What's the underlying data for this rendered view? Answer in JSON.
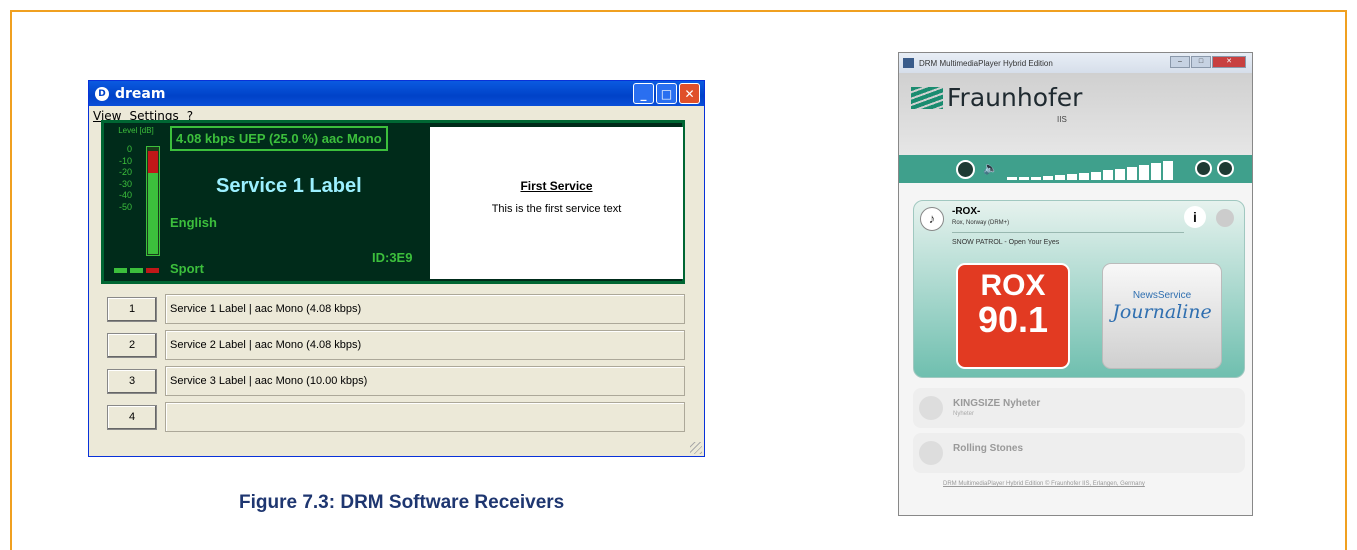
{
  "colors": {
    "frame_border": "#f0a020",
    "caption": "#1e3670",
    "dream_display_bg": "#002b1a",
    "dream_green": "#3cbf3c",
    "fraunhofer_teal": "#3fa08c",
    "rox_red": "#e23a22"
  },
  "dream": {
    "title": "dream",
    "menu": [
      "View",
      "Settings",
      "?"
    ],
    "level_label": "Level [dB]",
    "scale": [
      "0",
      "-10",
      "-20",
      "-30",
      "-40",
      "-50"
    ],
    "level_fraction": 0.8,
    "rate": "4.08 kbps UEP (25.0 %)  aac  Mono",
    "service_label": "Service 1 Label",
    "language": "English",
    "service_id": "ID:3E9",
    "genre": "Sport",
    "text_heading": "First Service",
    "text_body": "This is the first service text",
    "services": [
      {
        "num": "1",
        "desc": "Service 1 Label  |   aac Mono (4.08 kbps)"
      },
      {
        "num": "2",
        "desc": "Service 2 Label  |   aac Mono (4.08 kbps)"
      },
      {
        "num": "3",
        "desc": "Service 3 Label  |   aac Mono (10.00 kbps)"
      },
      {
        "num": "4",
        "desc": ""
      }
    ]
  },
  "caption": "Figure 7.3: DRM Software Receivers",
  "fraunhofer": {
    "title": "DRM MultimediaPlayer Hybrid Edition",
    "logo_name": "Fraunhofer",
    "logo_sub": "IIS",
    "volume_levels": [
      3,
      3,
      3,
      4,
      5,
      6,
      7,
      8,
      10,
      11,
      13,
      15,
      17,
      19
    ],
    "active_station": {
      "name": "-ROX-",
      "location": "Rox, Norway (DRM+)",
      "track": "SNOW PATROL - Open Your Eyes"
    },
    "rox_logo": {
      "line1": "ROX",
      "line2": "90.1"
    },
    "journaline": {
      "top": "NewsService",
      "name": "Journaline"
    },
    "stations": [
      {
        "name": "KINGSIZE Nyheter",
        "sub": "Nyheter"
      },
      {
        "name": "Rolling Stones",
        "sub": ""
      }
    ],
    "footer": "DRM MultimediaPlayer Hybrid Edition © Fraunhofer IIS, Erlangen, Germany"
  }
}
